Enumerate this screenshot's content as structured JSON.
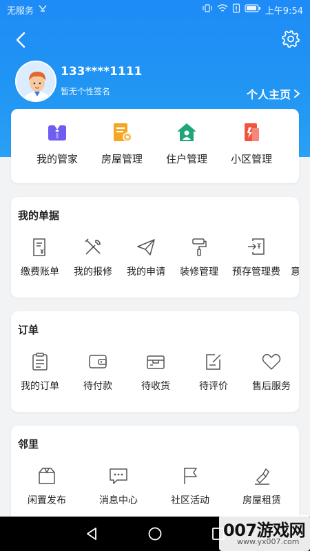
{
  "status_bar": {
    "carrier": "无服务",
    "time": "上午9:54"
  },
  "profile": {
    "phone": "133****1111",
    "signature": "暂无个性签名",
    "home_link": "个人主页"
  },
  "quick_actions": [
    {
      "label": "我的管家",
      "icon": "butler-icon"
    },
    {
      "label": "房屋管理",
      "icon": "house-doc-icon"
    },
    {
      "label": "住户管理",
      "icon": "resident-home-icon"
    },
    {
      "label": "小区管理",
      "icon": "community-icon"
    }
  ],
  "bills": {
    "title": "我的单据",
    "items": [
      {
        "label": "缴费账单",
        "icon": "bill-icon"
      },
      {
        "label": "我的报修",
        "icon": "repair-tools-icon"
      },
      {
        "label": "我的申请",
        "icon": "paper-plane-icon"
      },
      {
        "label": "装修管理",
        "icon": "paint-roller-icon"
      },
      {
        "label": "预存管理费",
        "icon": "prepay-icon"
      },
      {
        "label": "意见反馈",
        "icon": "feedback-icon"
      }
    ]
  },
  "orders": {
    "title": "订单",
    "items": [
      {
        "label": "我的订单",
        "icon": "clipboard-icon"
      },
      {
        "label": "待付款",
        "icon": "wallet-icon"
      },
      {
        "label": "待收货",
        "icon": "box-icon"
      },
      {
        "label": "待评价",
        "icon": "edit-note-icon"
      },
      {
        "label": "售后服务",
        "icon": "heart-icon"
      }
    ]
  },
  "neighbors": {
    "title": "邻里",
    "items": [
      {
        "label": "闲置发布",
        "icon": "idle-box-icon"
      },
      {
        "label": "消息中心",
        "icon": "chat-bubble-icon"
      },
      {
        "label": "社区活动",
        "icon": "flag-icon"
      },
      {
        "label": "房屋租赁",
        "icon": "rental-icon"
      }
    ]
  },
  "watermark": {
    "main": "007游戏网",
    "sub": "www.yx007.com"
  },
  "colors": {
    "primary": "#2196f3",
    "icon_purple": "#6f5cf0",
    "icon_orange": "#f5a623",
    "icon_green": "#1fa67a",
    "icon_red": "#f2553e",
    "text": "#222222"
  }
}
